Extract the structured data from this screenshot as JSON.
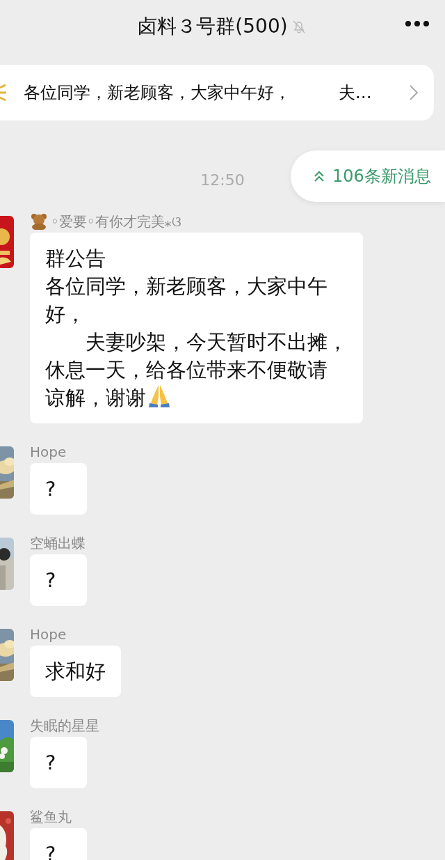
{
  "header": {
    "title": "卤料３号群(500)",
    "muted": true
  },
  "pinned": {
    "text": "各位同学，新老顾客，大家中午好，         夫…"
  },
  "new_messages": {
    "label": "106条新消息"
  },
  "time": "12:50",
  "messages": [
    {
      "sender": "◦爱要◦有你才完美⁎ଓ",
      "lines": [
        "群公告",
        "各位同学，新老顾客，大家中午",
        "好，",
        "　　夫妻吵架，今天暂时不出摊，",
        "休息一天，给各位带来不便敬请",
        "谅解，谢谢"
      ],
      "kind": "announcement"
    },
    {
      "sender": "Hope",
      "lines": [
        "?"
      ]
    },
    {
      "sender": "空蛹出蝶",
      "lines": [
        "?"
      ]
    },
    {
      "sender": "Hope",
      "lines": [
        "求和好"
      ]
    },
    {
      "sender": "失眠的星星",
      "lines": [
        "?"
      ]
    },
    {
      "sender": "鲨鱼丸",
      "lines": [
        "?"
      ]
    }
  ]
}
